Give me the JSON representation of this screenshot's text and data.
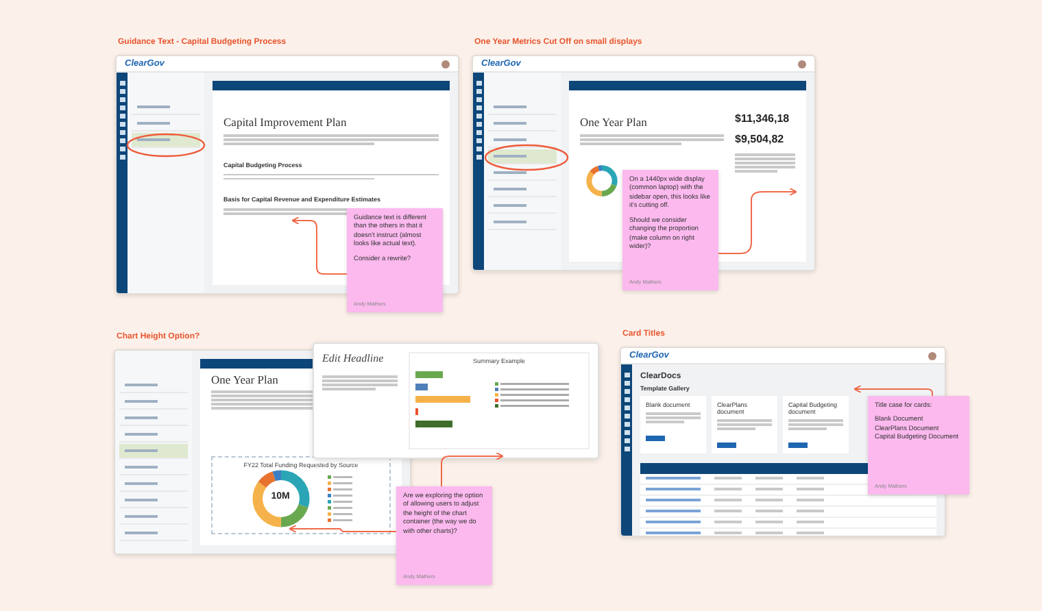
{
  "sections": [
    {
      "heading": "Guidance Text - Capital Budgeting Process",
      "screen": {
        "kind": "document",
        "logo": "ClearGov",
        "pages": [
          {
            "selected": false
          },
          {
            "selected": false
          },
          {
            "selected": true
          }
        ],
        "title": "Capital Improvement Plan",
        "subheadings": [
          "Capital Budgeting Process",
          "Basis for Capital Revenue and Expenditure Estimates"
        ]
      },
      "note": {
        "paragraphs": [
          "Guidance text is different than the others in that it doesn't instruct (almost looks like actual text).",
          "Consider a rewrite?"
        ],
        "author": "Andy Mathers"
      }
    },
    {
      "heading": "One Year Metrics Cut Off on small displays",
      "screen": {
        "kind": "metrics",
        "logo": "ClearGov",
        "pages": [
          {
            "selected": false
          },
          {
            "selected": false
          },
          {
            "selected": false
          },
          {
            "selected": true
          },
          {
            "selected": false
          },
          {
            "selected": false
          },
          {
            "selected": false
          },
          {
            "selected": false
          }
        ],
        "title": "One Year Plan",
        "metrics": [
          "$11,346,18",
          "$9,504,82"
        ]
      },
      "note": {
        "paragraphs": [
          "On a 1440px wide display (common laptop) with the sidebar open, this looks like it's cutting off.",
          "Should we consider changing the proportion (make column on right wider)?"
        ],
        "author": "Andy Mathers"
      }
    },
    {
      "heading": "Chart Height Option?",
      "screen": {
        "kind": "chart",
        "pages": [
          {
            "selected": false
          },
          {
            "selected": false
          },
          {
            "selected": false
          },
          {
            "selected": false
          },
          {
            "selected": true
          },
          {
            "selected": false
          },
          {
            "selected": false
          },
          {
            "selected": false
          },
          {
            "selected": false
          },
          {
            "selected": false
          }
        ],
        "title": "One Year Plan",
        "chart_title": "FY22 Total Funding Requested by Source",
        "donut_label": "10M",
        "popup": {
          "title": "Edit Headline",
          "chart_title": "Summary Example"
        }
      },
      "note": {
        "paragraphs": [
          "Are we exploring the option of allowing users to adjust the height of the chart container (the way we do with other charts)?"
        ],
        "author": "Andy Mathers"
      }
    },
    {
      "heading": "Card Titles",
      "screen": {
        "kind": "gallery",
        "logo": "ClearGov",
        "app_title": "ClearDocs",
        "gallery_title": "Template Gallery",
        "cards": [
          "Blank document",
          "ClearPlans document",
          "Capital Budgeting document"
        ]
      },
      "note": {
        "paragraphs": [
          "Title case for cards:",
          "Blank Document\nClearPlans Document\nCapital Budgeting Document"
        ],
        "author": "Andy Mathers"
      }
    }
  ]
}
